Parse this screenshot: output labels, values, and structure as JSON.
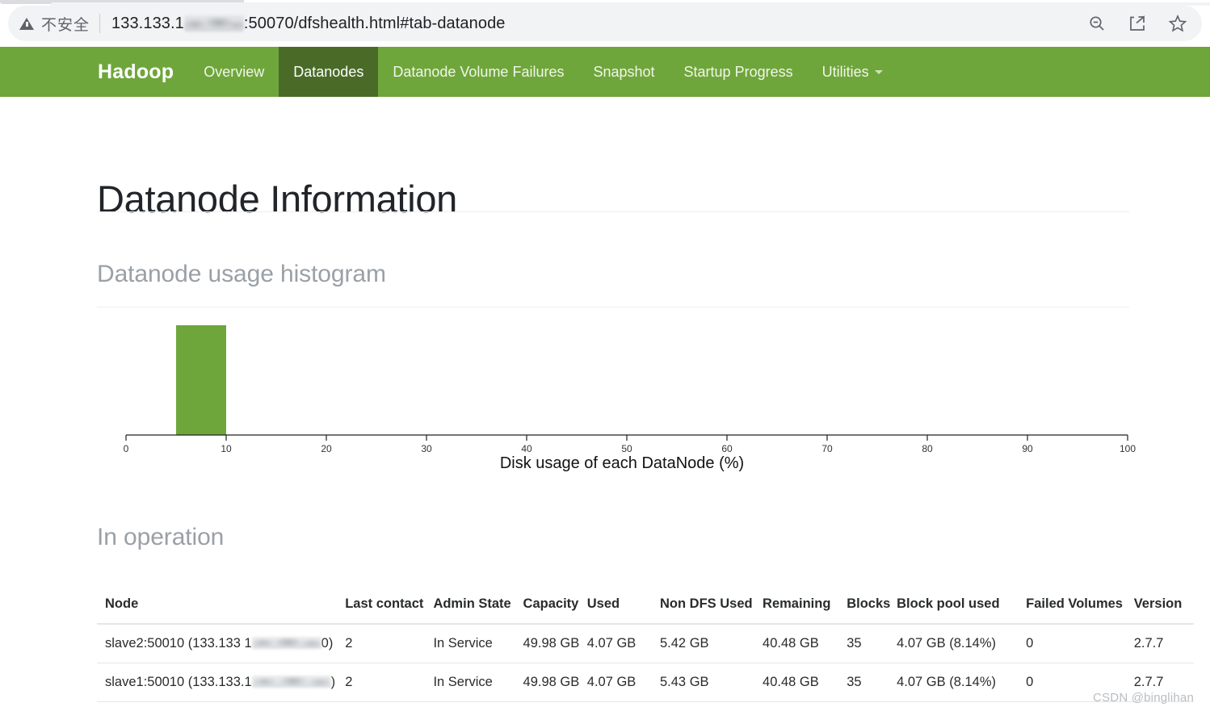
{
  "browser": {
    "security_label": "不安全",
    "url_prefix": "133.133.1",
    "url_suffix": ":50070/dfshealth.html#tab-datanode",
    "icons": [
      "zoom-out-icon",
      "share-icon",
      "bookmark-star-icon"
    ]
  },
  "navbar": {
    "brand": "Hadoop",
    "items": [
      {
        "label": "Overview",
        "active": false
      },
      {
        "label": "Datanodes",
        "active": true
      },
      {
        "label": "Datanode Volume Failures",
        "active": false
      },
      {
        "label": "Snapshot",
        "active": false
      },
      {
        "label": "Startup Progress",
        "active": false
      },
      {
        "label": "Utilities",
        "active": false,
        "has_caret": true
      }
    ],
    "brand_color": "#6fa63b",
    "active_color": "#4a6b28"
  },
  "page": {
    "title": "Datanode Information",
    "histogram_heading": "Datanode usage histogram",
    "in_operation_heading": "In operation",
    "watermark": "CSDN @binglihan"
  },
  "chart_data": {
    "type": "bar",
    "title": "Datanode usage histogram",
    "xlabel": "Disk usage of each DataNode (%)",
    "ylabel": "",
    "xlim": [
      0,
      100
    ],
    "ylim": [
      0,
      2
    ],
    "grid": false,
    "bar_color": "#6fa63b",
    "tick_labels": [
      "0",
      "10",
      "20",
      "30",
      "40",
      "50",
      "60",
      "70",
      "80",
      "90",
      "100"
    ],
    "ticks": [
      0,
      10,
      20,
      30,
      40,
      50,
      60,
      70,
      80,
      90,
      100
    ],
    "bins": [
      {
        "x0": 5,
        "x1": 10,
        "value": 2,
        "label": "2"
      }
    ],
    "categories": [
      "5-10"
    ],
    "values": [
      2
    ]
  },
  "table": {
    "columns": [
      "Node",
      "Last contact",
      "Admin State",
      "Capacity",
      "Used",
      "Non DFS Used",
      "Remaining",
      "Blocks",
      "Block pool used",
      "Failed Volumes",
      "Version"
    ],
    "rows": [
      {
        "node_prefix": "slave2:50010 (133.133 1",
        "node_suffix": "0)",
        "last_contact": "2",
        "admin_state": "In Service",
        "capacity": "49.98 GB",
        "used": "4.07 GB",
        "non_dfs_used": "5.42 GB",
        "remaining": "40.48 GB",
        "blocks": "35",
        "block_pool_used": "4.07 GB (8.14%)",
        "failed_volumes": "0",
        "version": "2.7.7"
      },
      {
        "node_prefix": "slave1:50010 (133.133.1",
        "node_suffix": ")",
        "last_contact": "2",
        "admin_state": "In Service",
        "capacity": "49.98 GB",
        "used": "4.07 GB",
        "non_dfs_used": "5.43 GB",
        "remaining": "40.48 GB",
        "blocks": "35",
        "block_pool_used": "4.07 GB (8.14%)",
        "failed_volumes": "0",
        "version": "2.7.7"
      }
    ]
  }
}
